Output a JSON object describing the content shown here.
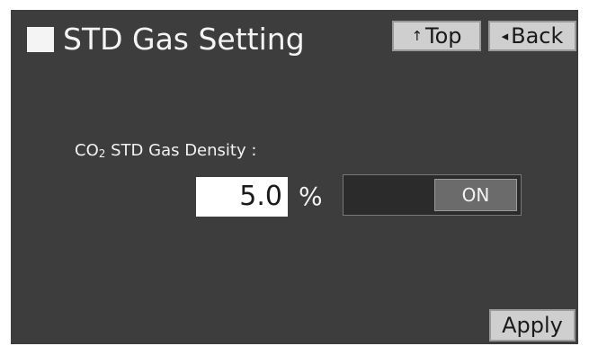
{
  "header": {
    "title": "STD Gas Setting",
    "top_button": {
      "arrow": "↑",
      "label": "Top"
    },
    "back_button": {
      "arrow": "◂",
      "label": "Back"
    }
  },
  "setting": {
    "label_prefix": "CO",
    "label_subscript": "2",
    "label_suffix": " STD Gas Density :",
    "value": "5.0",
    "unit": "%",
    "toggle_state": "ON"
  },
  "footer": {
    "apply_label": "Apply"
  },
  "colors": {
    "screen_background": "#3d3d3d",
    "button_background": "#cfcfcf",
    "toggle_track": "#2b2b2b",
    "toggle_knob": "#6b6b6b"
  },
  "icons": {
    "title_marker": "square-icon",
    "top_arrow": "up-arrow-icon",
    "back_arrow": "left-triangle-icon"
  }
}
